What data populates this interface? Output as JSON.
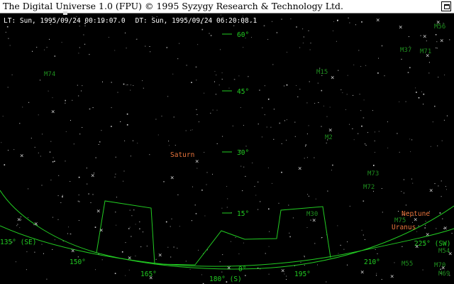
{
  "window": {
    "title": "The Digital Universe 1.0 (FPU) © 1995 Syzygy Research & Technology Ltd."
  },
  "status": {
    "local_time": "LT: Sun, 1995/09/24 00:19:07.0",
    "dynamic_time": "DT: Sun, 1995/09/24 06:20:08.1"
  },
  "altitude_labels": [
    "60°",
    "45°",
    "30°",
    "15°",
    "0°"
  ],
  "azimuth_labels": [
    "135° (SE)",
    "150°",
    "165°",
    "180° (S)",
    "195°",
    "210°",
    "225° (SW)"
  ],
  "planets": [
    {
      "name": "Saturn",
      "color": "#e8743c"
    },
    {
      "name": "Neptune",
      "color": "#e8743c"
    },
    {
      "name": "Uranus",
      "color": "#e8743c"
    }
  ],
  "messier_labels": [
    "M74",
    "M15",
    "M2",
    "M73",
    "M72",
    "M30",
    "M55",
    "M75",
    "M54",
    "M70",
    "M69",
    "M37",
    "M71",
    "M56"
  ],
  "colors": {
    "grid": "#22cc22",
    "label_green": "#1f8f1f",
    "planet": "#e8743c",
    "sky": "#000000",
    "titlebar": "#ffffff"
  }
}
